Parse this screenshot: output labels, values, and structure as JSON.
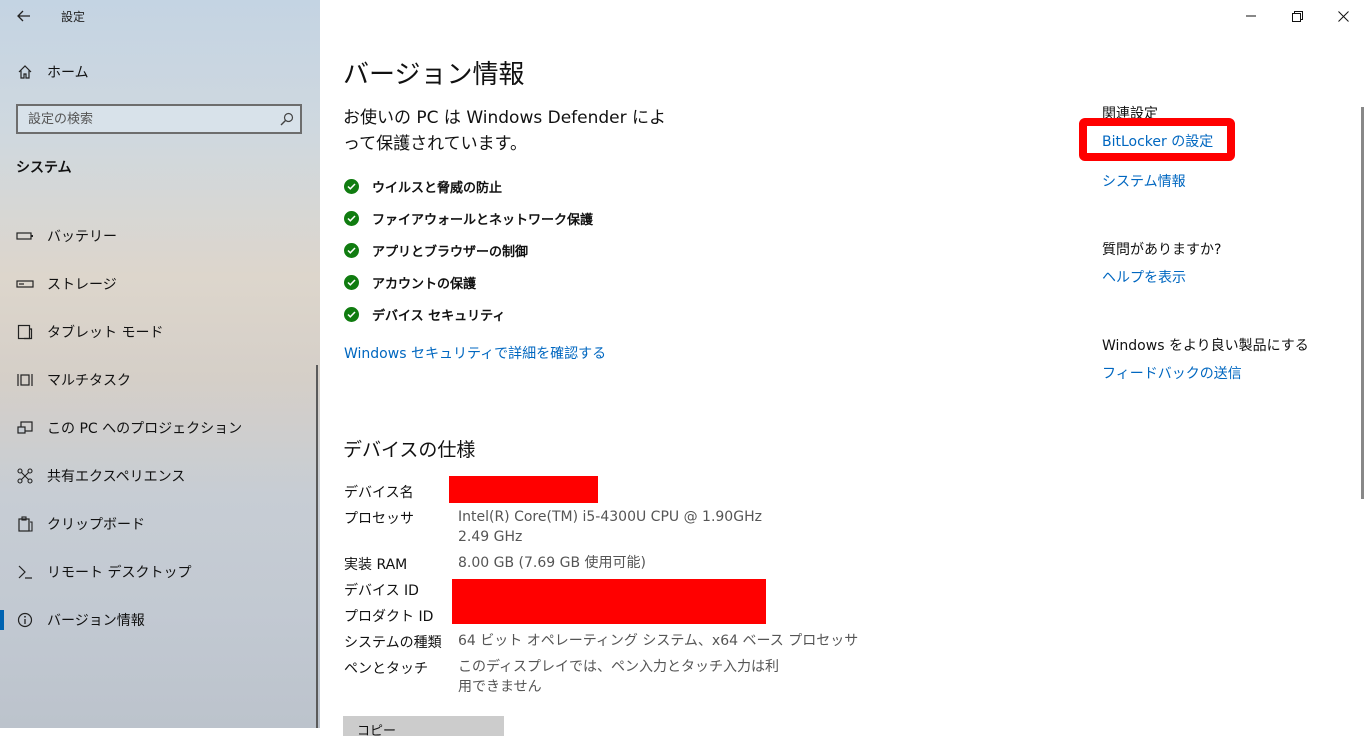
{
  "app": {
    "title": "設定"
  },
  "window_controls": {
    "minimize_glyph": "—",
    "maximize_glyph": "❐",
    "close_glyph": "✕"
  },
  "sidebar": {
    "home_label": "ホーム",
    "search_placeholder": "設定の検索",
    "section_label": "システム",
    "items": [
      {
        "label": "バッテリー",
        "icon": "battery-icon"
      },
      {
        "label": "ストレージ",
        "icon": "storage-icon"
      },
      {
        "label": "タブレット モード",
        "icon": "tablet-mode-icon"
      },
      {
        "label": "マルチタスク",
        "icon": "multitask-icon"
      },
      {
        "label": "この PC へのプロジェクション",
        "icon": "projection-icon"
      },
      {
        "label": "共有エクスペリエンス",
        "icon": "shared-experience-icon"
      },
      {
        "label": "クリップボード",
        "icon": "clipboard-icon"
      },
      {
        "label": "リモート デスクトップ",
        "icon": "remote-desktop-icon"
      },
      {
        "label": "バージョン情報",
        "icon": "info-icon",
        "active": true
      }
    ]
  },
  "main": {
    "title": "バージョン情報",
    "defender_text": "お使いの PC は Windows Defender によって保護されています。",
    "protections": [
      "ウイルスと脅威の防止",
      "ファイアウォールとネットワーク保護",
      "アプリとブラウザーの制御",
      "アカウントの保護",
      "デバイス セキュリティ"
    ],
    "security_link": "Windows セキュリティで詳細を確認する",
    "spec_header": "デバイスの仕様",
    "specs": {
      "device_name_label": "デバイス名",
      "processor_label": "プロセッサ",
      "processor_value": "Intel(R) Core(TM) i5-4300U CPU @ 1.90GHz   2.49 GHz",
      "ram_label": "実装 RAM",
      "ram_value": "8.00 GB (7.69 GB 使用可能)",
      "device_id_label": "デバイス ID",
      "product_id_label": "プロダクト ID",
      "system_type_label": "システムの種類",
      "system_type_value": "64 ビット オペレーティング システム、x64 ベース プロセッサ",
      "pen_touch_label": "ペンとタッチ",
      "pen_touch_value": "このディスプレイでは、ペン入力とタッチ入力は利用できません"
    },
    "bottom_button_label": "コピー"
  },
  "related": {
    "header": "関連設定",
    "bitlocker_link": "BitLocker の設定",
    "system_info_link": "システム情報",
    "question_header": "質問がありますか?",
    "help_link": "ヘルプを表示",
    "improve_header": "Windows をより良い製品にする",
    "feedback_link": "フィードバックの送信"
  },
  "colors": {
    "accent": "#0067c0",
    "check_green": "#107c10",
    "redaction": "#ff0000",
    "active_indicator": "#0063b1"
  }
}
